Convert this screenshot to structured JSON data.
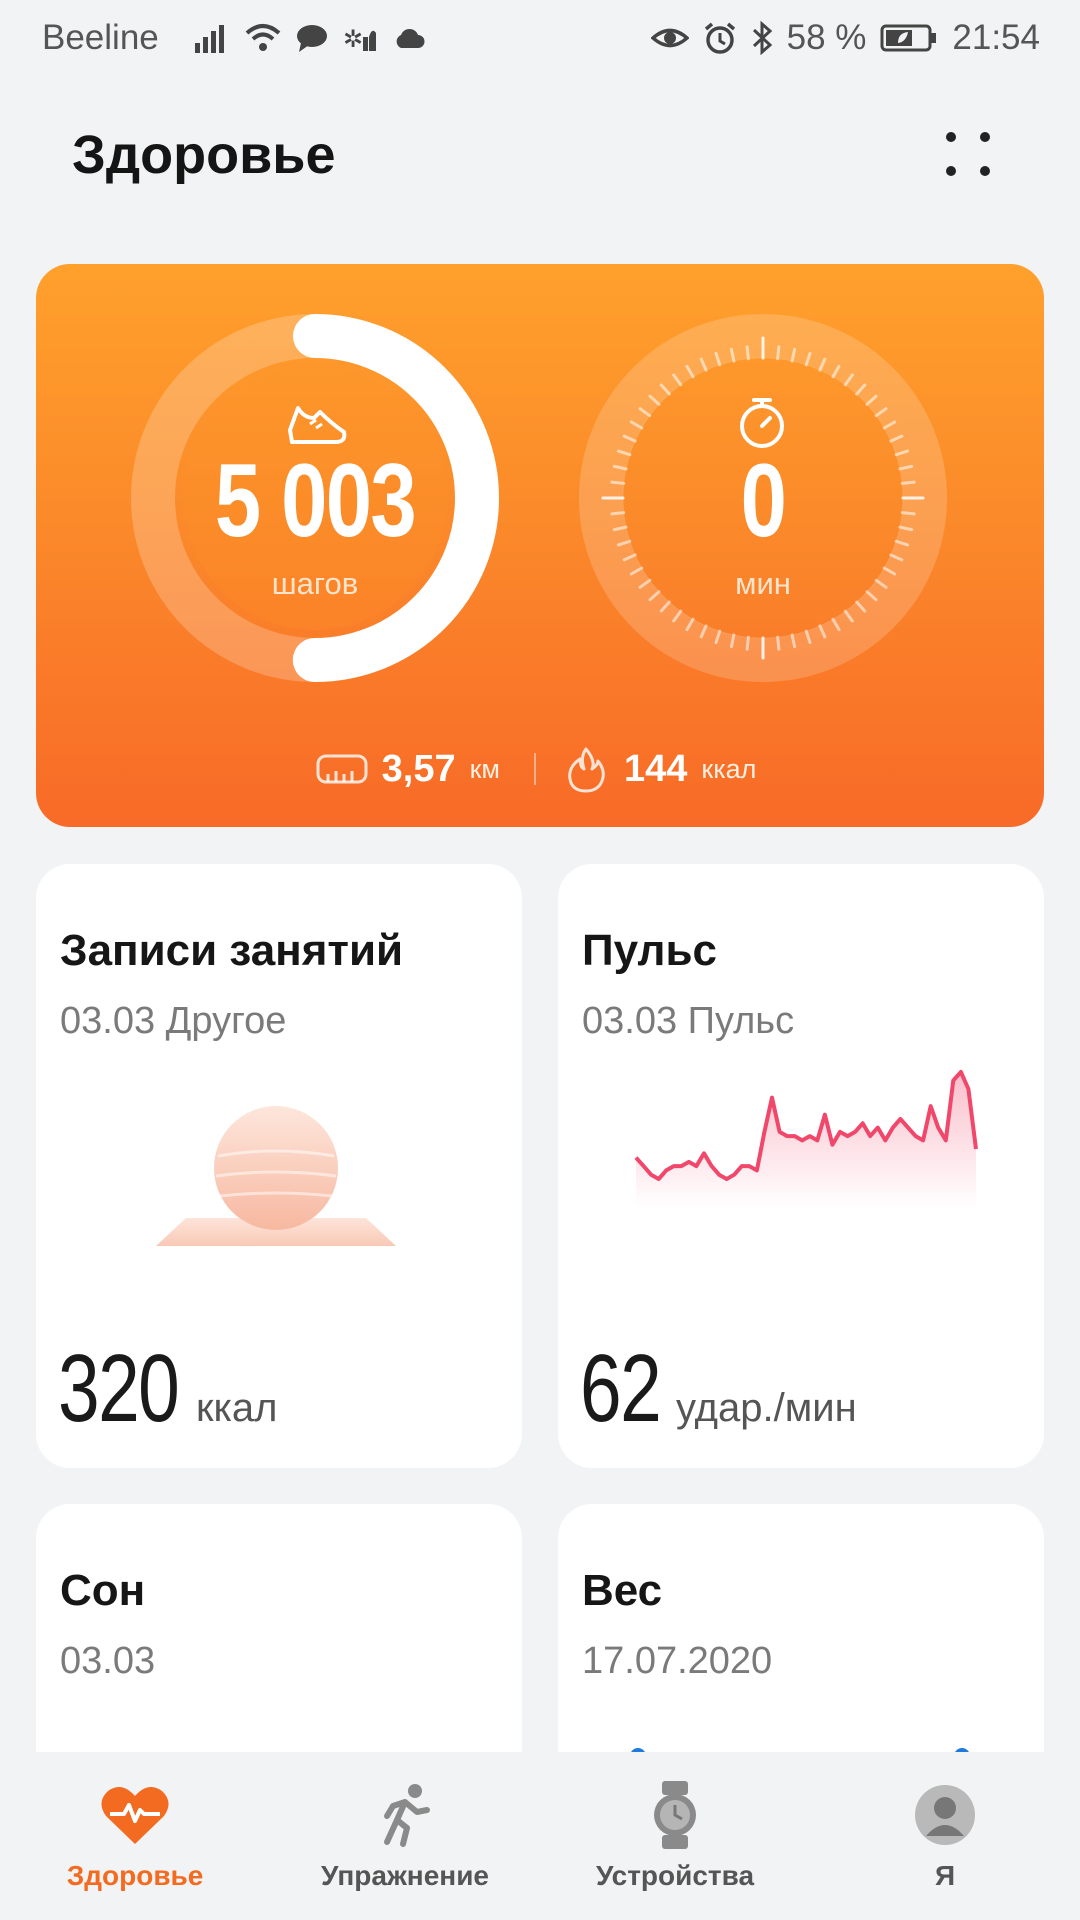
{
  "status_bar": {
    "carrier": "Beeline",
    "battery_percent": "58 %",
    "time": "21:54",
    "icons_left": [
      "signal-icon",
      "wifi-icon",
      "message-icon",
      "app-notification-icon",
      "cloud-icon"
    ],
    "icons_right": [
      "eye-icon",
      "alarm-icon",
      "bluetooth-icon",
      "battery-icon"
    ]
  },
  "header": {
    "title": "Здоровье"
  },
  "activity": {
    "steps_value": "5 003",
    "steps_unit": "шагов",
    "steps_goal_progress": 0.5,
    "active_minutes_value": "0",
    "active_minutes_unit": "мин",
    "distance_value": "3,57",
    "distance_unit": "км",
    "calories_value": "144",
    "calories_unit": "ккал",
    "colors": {
      "gradient_top": "#ffa02c",
      "gradient_bottom": "#f86a28"
    }
  },
  "cards": {
    "workouts": {
      "title": "Записи занятий",
      "subtitle": "03.03 Другое",
      "value": "320",
      "unit": "ккал"
    },
    "heart_rate": {
      "title": "Пульс",
      "subtitle": "03.03 Пульс",
      "value": "62",
      "unit": "удар./мин",
      "line_color": "#f0476a"
    },
    "sleep": {
      "title": "Сон",
      "subtitle": "03.03"
    },
    "weight": {
      "title": "Вес",
      "subtitle": "17.07.2020"
    }
  },
  "chart_data": {
    "type": "line",
    "series": [
      {
        "values": [
          72,
          70,
          68,
          67,
          69,
          70,
          70,
          71,
          70,
          73,
          70,
          68,
          67,
          68,
          70,
          70,
          69,
          78,
          86,
          78,
          77,
          77,
          76,
          77,
          76,
          82,
          75,
          78,
          77,
          78,
          80,
          77,
          79,
          76,
          79,
          81,
          79,
          77,
          76,
          84,
          79,
          76,
          90,
          92,
          88,
          74
        ]
      }
    ]
  },
  "bottom_nav": {
    "items": [
      {
        "label": "Здоровье",
        "icon": "heart-pulse-icon",
        "active": true
      },
      {
        "label": "Упражнение",
        "icon": "running-person-icon",
        "active": false
      },
      {
        "label": "Устройства",
        "icon": "smartwatch-icon",
        "active": false
      },
      {
        "label": "Я",
        "icon": "profile-avatar-icon",
        "active": false
      }
    ],
    "active_color": "#f26b21"
  }
}
